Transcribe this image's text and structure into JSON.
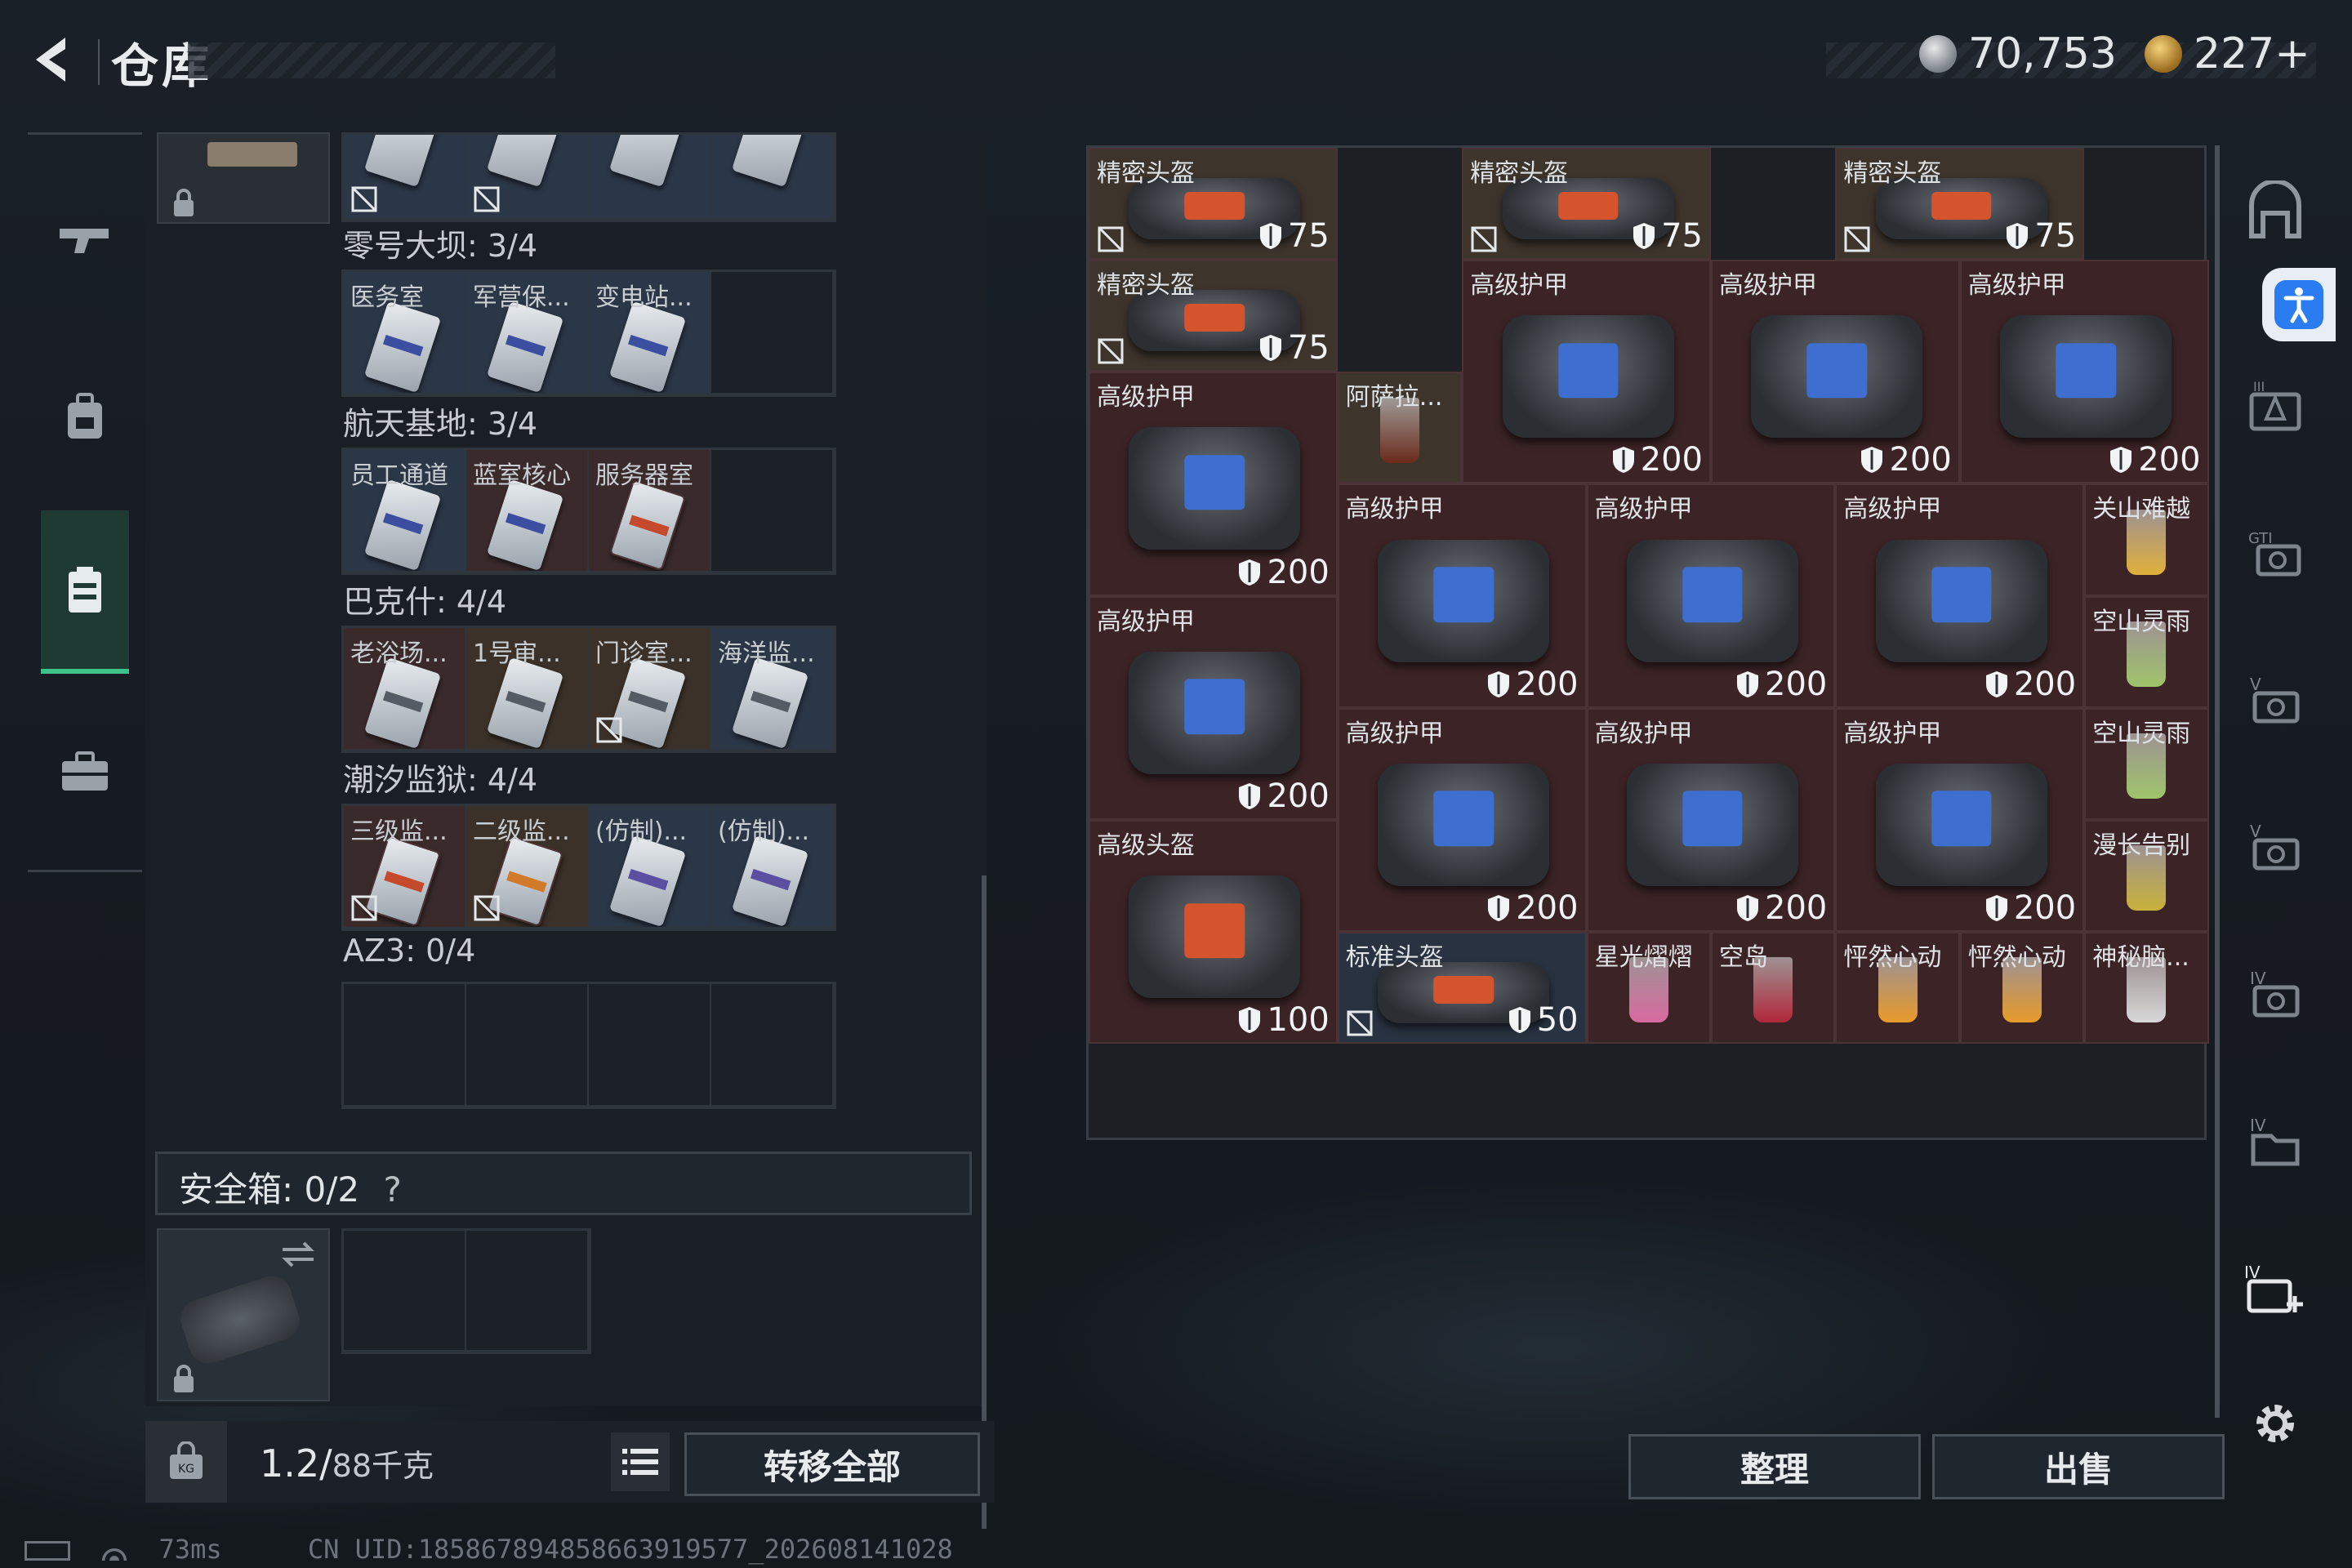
{
  "header": {
    "title": "仓库",
    "currency1": "70,753",
    "currency2": "227+"
  },
  "left_stash": {
    "sections": [
      {
        "label": "零号大坝: 3/4",
        "cells": [
          "医务室",
          "军营保...",
          "变电站...",
          ""
        ]
      },
      {
        "label": "航天基地: 3/4",
        "cells": [
          "员工通道",
          "蓝室核心",
          "服务器室",
          ""
        ]
      },
      {
        "label": "巴克什: 4/4",
        "cells": [
          "老浴场...",
          "1号审...",
          "门诊室...",
          "海洋监..."
        ]
      },
      {
        "label": "潮汐监狱: 4/4",
        "cells": [
          "三级监...",
          "二级监...",
          "(仿制)...",
          "(仿制)..."
        ]
      },
      {
        "label": "AZ3: 0/4",
        "cells": [
          "",
          "",
          "",
          ""
        ]
      }
    ],
    "safebox": "安全箱: 0/2",
    "help": "?",
    "weight": "1.2/",
    "weight_cap": "88千克",
    "transfer_all": "转移全部"
  },
  "right_stash": {
    "items": [
      {
        "name": "精密头盔",
        "dur": "75",
        "type": "helmet",
        "bg": "br"
      },
      {
        "name": "精密头盔",
        "dur": "75",
        "type": "helmet",
        "bg": "br"
      },
      {
        "name": "精密头盔",
        "dur": "75",
        "type": "helmet",
        "bg": "br"
      },
      {
        "name": "精密头盔",
        "dur": "75",
        "type": "helmet",
        "bg": "br"
      },
      {
        "name": "高级护甲",
        "dur": "200",
        "type": "armor",
        "bg": "rl"
      },
      {
        "name": "高级护甲",
        "dur": "200",
        "type": "armor",
        "bg": "rl"
      },
      {
        "name": "高级护甲",
        "dur": "200",
        "type": "armor",
        "bg": "rl"
      },
      {
        "name": "高级护甲",
        "dur": "200",
        "type": "armor",
        "bg": "rl"
      },
      {
        "name": "阿萨拉...",
        "dur": "",
        "type": "drink",
        "bg": "br"
      },
      {
        "name": "高级护甲",
        "dur": "200",
        "type": "armor",
        "bg": "rl"
      },
      {
        "name": "高级护甲",
        "dur": "200",
        "type": "armor",
        "bg": "rl"
      },
      {
        "name": "高级护甲",
        "dur": "200",
        "type": "armor",
        "bg": "rl"
      },
      {
        "name": "关山难越",
        "dur": "",
        "type": "drink",
        "bg": "rl"
      },
      {
        "name": "高级护甲",
        "dur": "200",
        "type": "armor",
        "bg": "rl"
      },
      {
        "name": "高级护甲",
        "dur": "200",
        "type": "armor",
        "bg": "rl"
      },
      {
        "name": "高级护甲",
        "dur": "200",
        "type": "armor",
        "bg": "rl"
      },
      {
        "name": "高级护甲",
        "dur": "200",
        "type": "armor",
        "bg": "rl"
      },
      {
        "name": "空山灵雨",
        "dur": "",
        "type": "drink",
        "bg": "rl"
      },
      {
        "name": "空山灵雨",
        "dur": "",
        "type": "drink",
        "bg": "rl"
      },
      {
        "name": "高级头盔",
        "dur": "100",
        "type": "helmet",
        "bg": "rl"
      },
      {
        "name": "漫长告别",
        "dur": "",
        "type": "drink",
        "bg": "rl"
      },
      {
        "name": "标准头盔",
        "dur": "50",
        "type": "helmet",
        "bg": "bl"
      },
      {
        "name": "星光熠熠",
        "dur": "",
        "type": "drink",
        "bg": "rl"
      },
      {
        "name": "空岛",
        "dur": "",
        "type": "drink",
        "bg": "rl"
      },
      {
        "name": "怦然心动",
        "dur": "",
        "type": "drink",
        "bg": "rl"
      },
      {
        "name": "怦然心动",
        "dur": "",
        "type": "drink",
        "bg": "rl"
      },
      {
        "name": "神秘脑...",
        "dur": "",
        "type": "drink",
        "bg": "rl"
      }
    ],
    "sort_label": "整理",
    "sell_label": "出售"
  },
  "status": {
    "ping": "73ms",
    "uid": "CN UID:185867894858663919577_202608141028"
  },
  "colors": {
    "accent_green": "#3fc18a",
    "armor_blue": "#3e6fd0",
    "helmet_orange": "#d5542d"
  }
}
